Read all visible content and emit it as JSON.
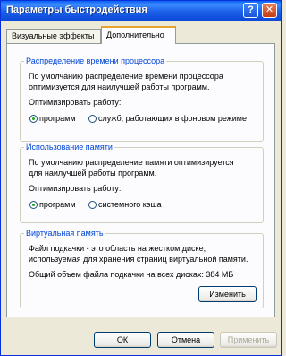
{
  "window": {
    "title": "Параметры быстродействия"
  },
  "titlebar": {
    "help_glyph": "?",
    "close_glyph": "✕"
  },
  "tabs": [
    {
      "label": "Визуальные эффекты"
    },
    {
      "label": "Дополнительно"
    }
  ],
  "cpu": {
    "title": "Распределение времени процессора",
    "desc1": "По умолчанию распределение времени процессора",
    "desc2": "оптимизуется для наилучшей работы программ.",
    "optimize_label": "Оптимизировать работу:",
    "option1": "программ",
    "option2": "служб, работающих в фоновом режиме",
    "selected": "программ"
  },
  "memory": {
    "title": "Использование памяти",
    "desc1": "По умолчанию распределение памяти оптимизируется",
    "desc2": "для наилучшей работы программ.",
    "optimize_label": "Оптимизировать работу:",
    "option1": "программ",
    "option2": "системного кэша",
    "selected": "программ"
  },
  "virtual": {
    "title": "Виртуальная память",
    "desc1": "Файл подкачки - это область на жестком диске,",
    "desc2": "используемая для хранения страниц виртуальной памяти.",
    "total_text": "Общий объем файла подкачки на всех дисках: 384 МБ",
    "change_button": "Изменить"
  },
  "footer": {
    "ok": "ОК",
    "cancel": "Отмена",
    "apply": "Применить"
  },
  "colors": {
    "titlebar": "#0A5FF6",
    "group_title": "#0046D5",
    "tab_highlight": "#E7A32E",
    "radio_selected": "#22A322"
  }
}
